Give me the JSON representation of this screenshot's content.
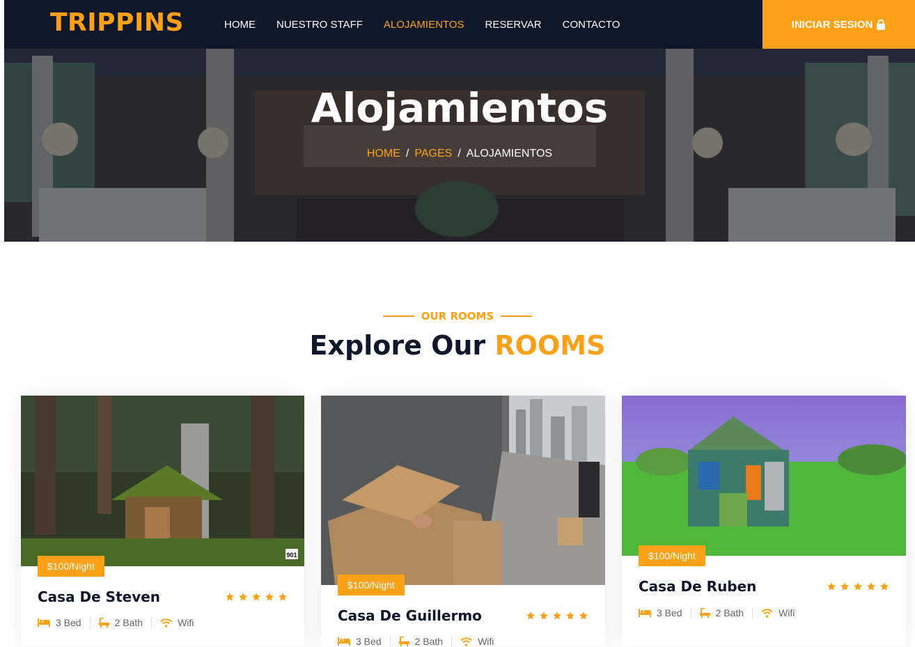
{
  "brand": "TRIPPINS",
  "nav": {
    "items": [
      {
        "label": "HOME"
      },
      {
        "label": "NUESTRO STAFF"
      },
      {
        "label": "ALOJAMIENTOS"
      },
      {
        "label": "RESERVAR"
      },
      {
        "label": "CONTACTO"
      }
    ],
    "active_index": 2,
    "login_label": "INICIAR SESION"
  },
  "hero": {
    "title": "Alojamientos",
    "breadcrumb": [
      "HOME",
      "PAGES",
      "ALOJAMIENTOS"
    ]
  },
  "section": {
    "subtitle": "OUR ROOMS",
    "title_part1": "Explore Our",
    "title_accent": "ROOMS"
  },
  "rooms": [
    {
      "name": "Casa De Steven",
      "price": "$100/Night",
      "rating": 5,
      "amenities": {
        "bed": "3 Bed",
        "bath": "2 Bath",
        "wifi": "Wifi"
      },
      "image": "fantasy stone cottage in forest",
      "image_badge": "901"
    },
    {
      "name": "Casa De Guillermo",
      "price": "$100/Night",
      "rating": 5,
      "amenities": {
        "bed": "3 Bed",
        "bath": "2 Bath",
        "wifi": "Wifi"
      },
      "image": "cardboard boxes on city sidewalk"
    },
    {
      "name": "Casa De Ruben",
      "price": "$100/Night",
      "rating": 5,
      "amenities": {
        "bed": "3 Bed",
        "bath": "2 Bath",
        "wifi": "Wifi"
      },
      "image": "patchwork shack in green field"
    }
  ],
  "colors": {
    "primary": "#fea116",
    "dark": "#0f172b",
    "text": "#666565"
  },
  "icons": {
    "login": "lock-icon",
    "bed": "bed-icon",
    "bath": "bath-icon",
    "wifi": "wifi-icon",
    "rating": "star-icon"
  }
}
